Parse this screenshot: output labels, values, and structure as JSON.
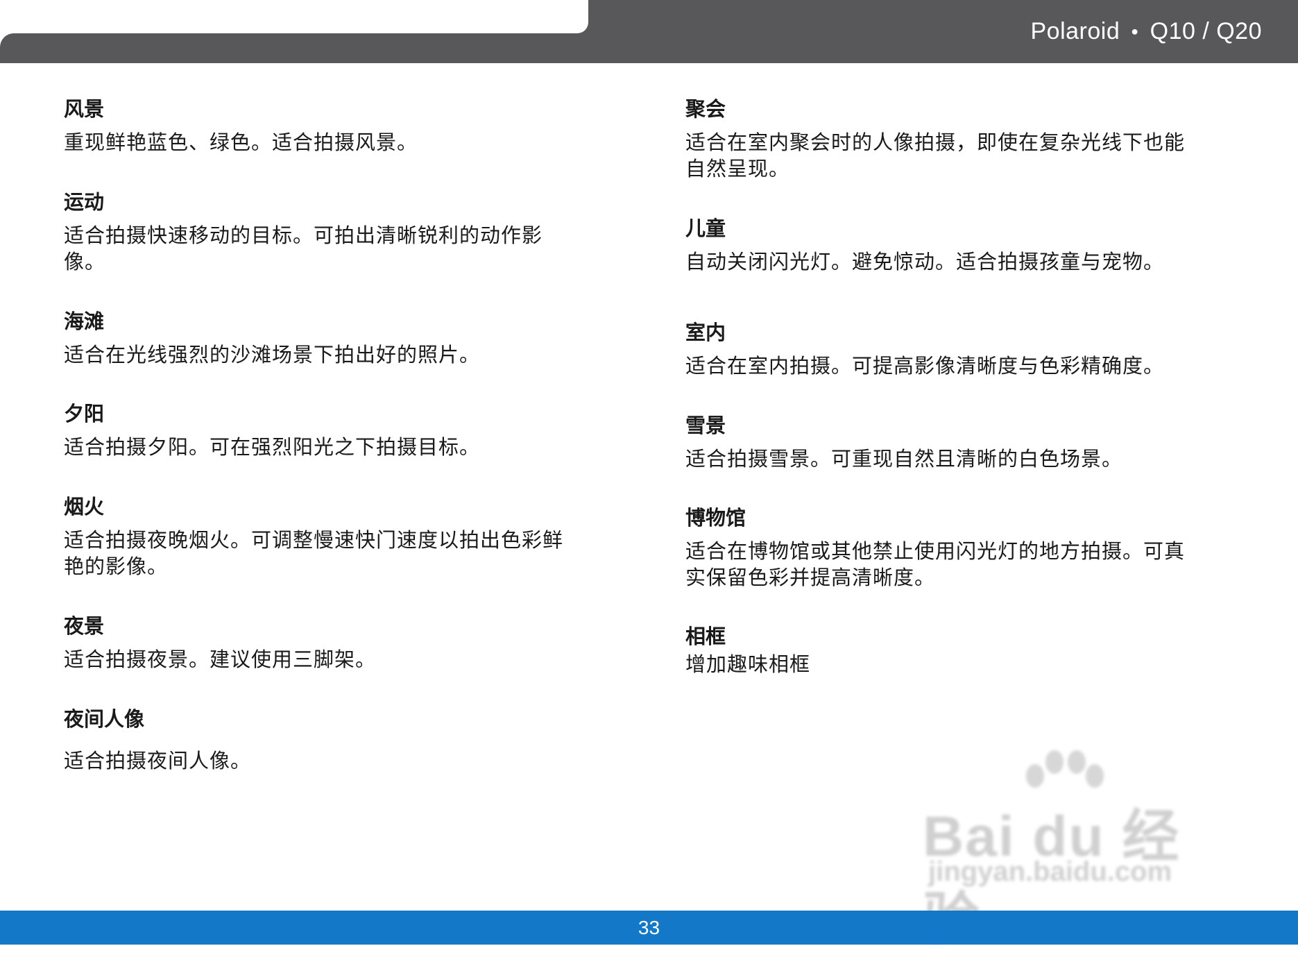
{
  "header": {
    "brand": "Polaroid",
    "model": "Q10 / Q20",
    "separator": "●"
  },
  "left_column": [
    {
      "title": "风景",
      "body": "重现鲜艳蓝色、绿色。适合拍摄风景。"
    },
    {
      "title": "运动",
      "body": "适合拍摄快速移动的目标。可拍出清晰锐利的动作影\n像。"
    },
    {
      "title": "海滩",
      "body": "适合在光线强烈的沙滩场景下拍出好的照片。"
    },
    {
      "title": "夕阳",
      "body": "适合拍摄夕阳。可在强烈阳光之下拍摄目标。"
    },
    {
      "title": "烟火",
      "body": "适合拍摄夜晚烟火。可调整慢速快门速度以拍出色彩鲜\n艳的影像。"
    },
    {
      "title": "夜景",
      "body": "适合拍摄夜景。建议使用三脚架。"
    },
    {
      "title": "夜间人像",
      "body": "适合拍摄夜间人像。"
    }
  ],
  "right_column": [
    {
      "title": "聚会",
      "body": "适合在室内聚会时的人像拍摄，即使在复杂光线下也能\n自然呈现。"
    },
    {
      "title": "儿童",
      "body": "自动关闭闪光灯。避免惊动。适合拍摄孩童与宠物。"
    },
    {
      "title": "室内",
      "body": "适合在室内拍摄。可提高影像清晰度与色彩精确度。"
    },
    {
      "title": "雪景",
      "body": "适合拍摄雪景。可重现自然且清晰的白色场景。"
    },
    {
      "title": "博物馆",
      "body": "适合在博物馆或其他禁止使用闪光灯的地方拍摄。可真\n实保留色彩并提高清晰度。"
    },
    {
      "title": "相框",
      "body": "增加趣味相框"
    }
  ],
  "watermark": {
    "brand": "Bai du 经验",
    "url": "jingyan.baidu.com"
  },
  "footer": {
    "page_number": "33"
  },
  "colors": {
    "header_bg": "#58575a",
    "footer_bg": "#1478c8",
    "text": "#1a1a1a"
  }
}
